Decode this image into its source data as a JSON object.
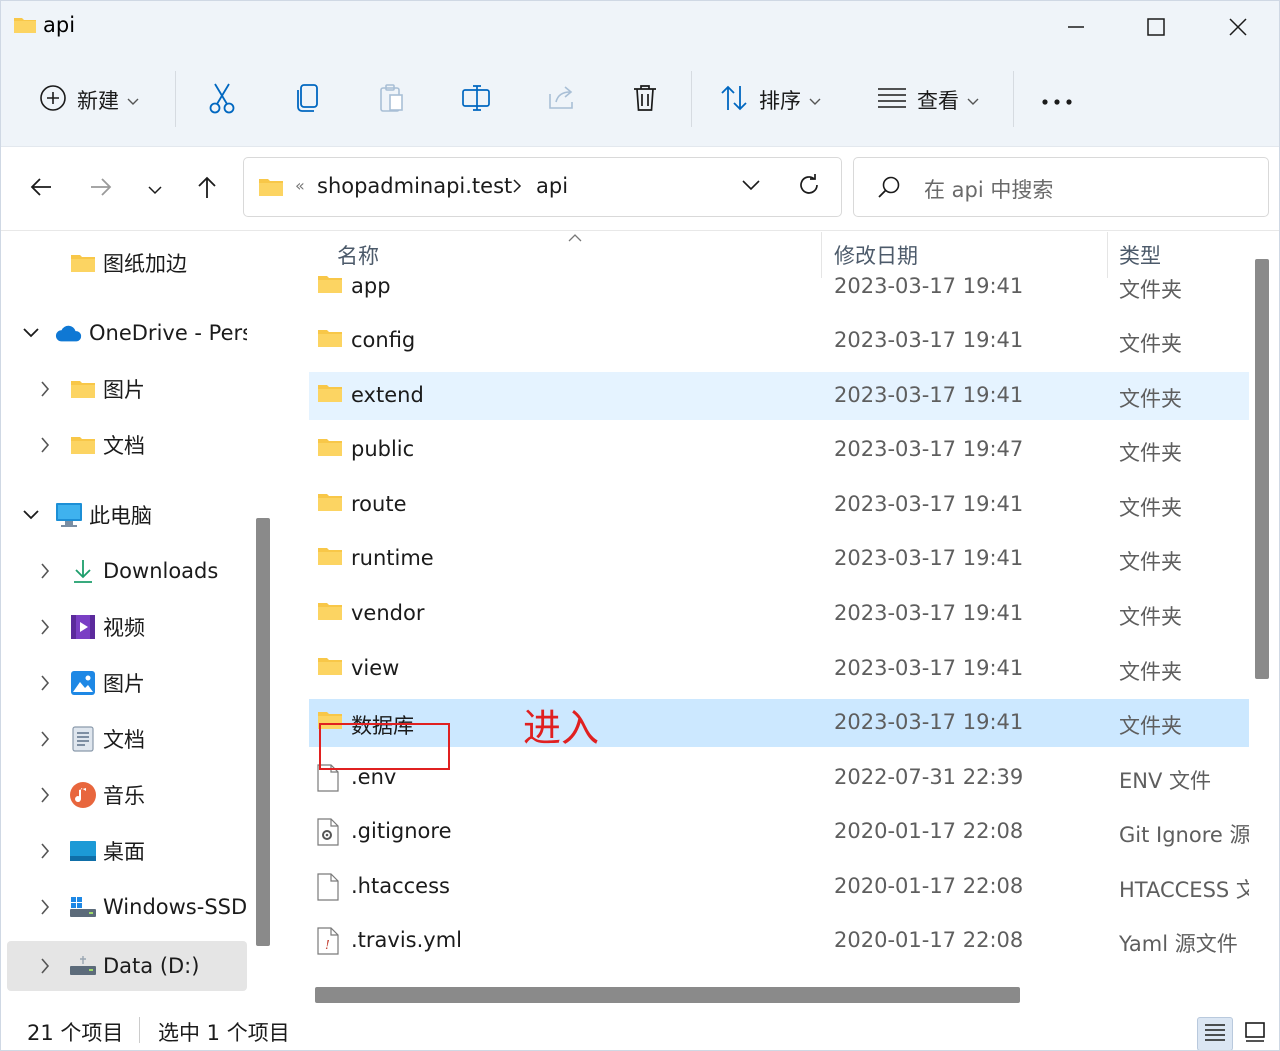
{
  "window": {
    "title": "api"
  },
  "toolbar": {
    "new_label": "新建",
    "sort_label": "排序",
    "view_label": "查看",
    "more_label": "•••"
  },
  "address": {
    "overflow": "«",
    "segments": [
      "shopadminapi.test",
      "api"
    ],
    "search_placeholder": "在 api 中搜索"
  },
  "sidebar": {
    "items": [
      {
        "label": "图纸加边",
        "icon": "folder-icon"
      },
      {
        "label": "OneDrive - Pers",
        "icon": "onedrive-icon"
      },
      {
        "label": "图片",
        "icon": "folder-icon"
      },
      {
        "label": "文档",
        "icon": "folder-icon"
      },
      {
        "label": "此电脑",
        "icon": "computer-icon"
      },
      {
        "label": "Downloads",
        "icon": "download-icon"
      },
      {
        "label": "视频",
        "icon": "video-icon"
      },
      {
        "label": "图片",
        "icon": "pictures-icon"
      },
      {
        "label": "文档",
        "icon": "documents-icon"
      },
      {
        "label": "音乐",
        "icon": "music-icon"
      },
      {
        "label": "桌面",
        "icon": "desktop-icon"
      },
      {
        "label": "Windows-SSD",
        "icon": "drive-icon"
      },
      {
        "label": "Data (D:)",
        "icon": "drive-icon"
      }
    ]
  },
  "columns": {
    "name": "名称",
    "date": "修改日期",
    "type": "类型"
  },
  "files": [
    {
      "name": "app",
      "date": "2023-03-17 19:41",
      "type": "文件夹",
      "icon": "folder-icon"
    },
    {
      "name": "config",
      "date": "2023-03-17 19:41",
      "type": "文件夹",
      "icon": "folder-icon"
    },
    {
      "name": "extend",
      "date": "2023-03-17 19:41",
      "type": "文件夹",
      "icon": "folder-icon"
    },
    {
      "name": "public",
      "date": "2023-03-17 19:47",
      "type": "文件夹",
      "icon": "folder-icon"
    },
    {
      "name": "route",
      "date": "2023-03-17 19:41",
      "type": "文件夹",
      "icon": "folder-icon"
    },
    {
      "name": "runtime",
      "date": "2023-03-17 19:41",
      "type": "文件夹",
      "icon": "folder-icon"
    },
    {
      "name": "vendor",
      "date": "2023-03-17 19:41",
      "type": "文件夹",
      "icon": "folder-icon"
    },
    {
      "name": "view",
      "date": "2023-03-17 19:41",
      "type": "文件夹",
      "icon": "folder-icon"
    },
    {
      "name": "数据库",
      "date": "2023-03-17 19:41",
      "type": "文件夹",
      "icon": "folder-icon"
    },
    {
      "name": ".env",
      "date": "2022-07-31 22:39",
      "type": "ENV 文件",
      "icon": "file-icon"
    },
    {
      "name": ".gitignore",
      "date": "2020-01-17 22:08",
      "type": "Git Ignore 源",
      "icon": "gear-file-icon"
    },
    {
      "name": ".htaccess",
      "date": "2020-01-17 22:08",
      "type": "HTACCESS 文",
      "icon": "file-icon"
    },
    {
      "name": ".travis.yml",
      "date": "2020-01-17 22:08",
      "type": "Yaml 源文件",
      "icon": "yaml-file-icon"
    }
  ],
  "annotation": {
    "text": "进入"
  },
  "status": {
    "count": "21 个项目",
    "selected": "选中 1 个项目"
  },
  "colors": {
    "accent": "#0067c0",
    "folder": "#f8c748",
    "selection": "#cce8ff",
    "hover": "#e5f3ff",
    "annotation": "#e02020"
  }
}
